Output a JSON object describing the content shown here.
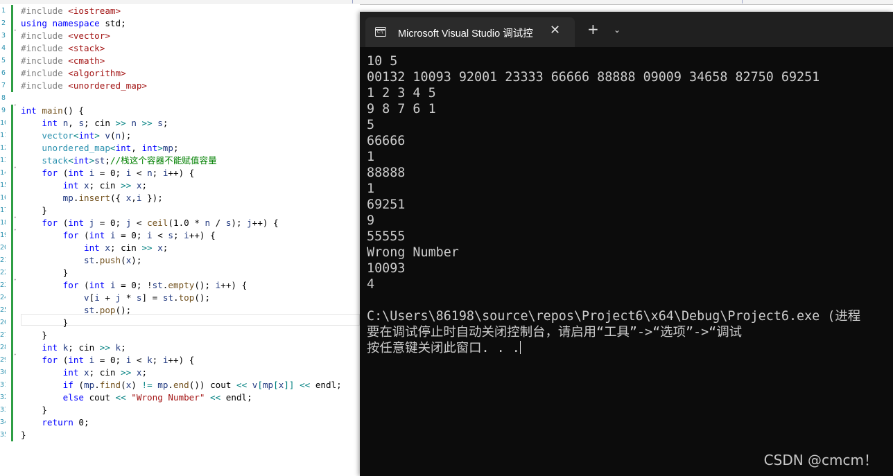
{
  "editor": {
    "line_numbers": [
      "1",
      "2",
      "3",
      "4",
      "5",
      "6",
      "7",
      "8",
      "9",
      "10",
      "11",
      "12",
      "13",
      "14",
      "15",
      "16",
      "17",
      "18",
      "19",
      "20",
      "21",
      "22",
      "23",
      "24",
      "25",
      "26",
      "27",
      "28",
      "29",
      "30",
      "31",
      "32",
      "33",
      "34",
      "35"
    ],
    "lines": [
      [
        [
          "pp",
          "#include "
        ],
        [
          "str",
          "<iostream>"
        ]
      ],
      [
        [
          "kw",
          "using namespace "
        ],
        [
          "",
          "std;"
        ]
      ],
      [
        [
          "pp",
          "#include "
        ],
        [
          "str",
          "<vector>"
        ]
      ],
      [
        [
          "pp",
          "#include "
        ],
        [
          "str",
          "<stack>"
        ]
      ],
      [
        [
          "pp",
          "#include "
        ],
        [
          "str",
          "<cmath>"
        ]
      ],
      [
        [
          "pp",
          "#include "
        ],
        [
          "str",
          "<algorithm>"
        ]
      ],
      [
        [
          "pp",
          "#include "
        ],
        [
          "str",
          "<unordered_map>"
        ]
      ],
      [],
      [
        [
          "kw",
          "int "
        ],
        [
          "fn",
          "main"
        ],
        [
          "",
          "() {"
        ]
      ],
      [
        [
          "",
          "    "
        ],
        [
          "kw",
          "int "
        ],
        [
          "var",
          "n"
        ],
        [
          "",
          ", "
        ],
        [
          "var",
          "s"
        ],
        [
          "",
          "; cin "
        ],
        [
          "op",
          ">>"
        ],
        [
          "",
          " "
        ],
        [
          "var",
          "n"
        ],
        [
          "",
          " "
        ],
        [
          "op",
          ">>"
        ],
        [
          "",
          " "
        ],
        [
          "var",
          "s"
        ],
        [
          "",
          ";"
        ]
      ],
      [
        [
          "",
          "    "
        ],
        [
          "typ",
          "vector"
        ],
        [
          "op",
          "<"
        ],
        [
          "kw",
          "int"
        ],
        [
          "op",
          ">"
        ],
        [
          "",
          " "
        ],
        [
          "var",
          "v"
        ],
        [
          "",
          "("
        ],
        [
          "var",
          "n"
        ],
        [
          "",
          ");"
        ]
      ],
      [
        [
          "",
          "    "
        ],
        [
          "typ",
          "unordered_map"
        ],
        [
          "op",
          "<"
        ],
        [
          "kw",
          "int"
        ],
        [
          "",
          ", "
        ],
        [
          "kw",
          "int"
        ],
        [
          "op",
          ">"
        ],
        [
          "var",
          "mp"
        ],
        [
          "",
          ";"
        ]
      ],
      [
        [
          "",
          "    "
        ],
        [
          "typ",
          "stack"
        ],
        [
          "op",
          "<"
        ],
        [
          "kw",
          "int"
        ],
        [
          "op",
          ">"
        ],
        [
          "var",
          "st"
        ],
        [
          "",
          ";"
        ],
        [
          "cmt",
          "//栈这个容器不能赋值容量"
        ]
      ],
      [
        [
          "",
          "    "
        ],
        [
          "kw",
          "for "
        ],
        [
          "",
          "("
        ],
        [
          "kw",
          "int "
        ],
        [
          "var",
          "i"
        ],
        [
          "",
          " = 0; "
        ],
        [
          "var",
          "i"
        ],
        [
          "",
          " < "
        ],
        [
          "var",
          "n"
        ],
        [
          "",
          "; "
        ],
        [
          "var",
          "i"
        ],
        [
          "",
          "++) {"
        ]
      ],
      [
        [
          "",
          "        "
        ],
        [
          "kw",
          "int "
        ],
        [
          "var",
          "x"
        ],
        [
          "",
          "; cin "
        ],
        [
          "op",
          ">>"
        ],
        [
          "",
          " "
        ],
        [
          "var",
          "x"
        ],
        [
          "",
          ";"
        ]
      ],
      [
        [
          "",
          "        "
        ],
        [
          "var",
          "mp"
        ],
        [
          "",
          "."
        ],
        [
          "fn",
          "insert"
        ],
        [
          "",
          "({ "
        ],
        [
          "var",
          "x"
        ],
        [
          "",
          ","
        ],
        [
          "var",
          "i"
        ],
        [
          "",
          " });"
        ]
      ],
      [
        [
          "",
          "    }"
        ]
      ],
      [
        [
          "",
          "    "
        ],
        [
          "kw",
          "for "
        ],
        [
          "",
          "("
        ],
        [
          "kw",
          "int "
        ],
        [
          "var",
          "j"
        ],
        [
          "",
          " = 0; "
        ],
        [
          "var",
          "j"
        ],
        [
          "",
          " < "
        ],
        [
          "fn",
          "ceil"
        ],
        [
          "",
          "(1.0 * "
        ],
        [
          "var",
          "n"
        ],
        [
          "",
          " / "
        ],
        [
          "var",
          "s"
        ],
        [
          "",
          "); "
        ],
        [
          "var",
          "j"
        ],
        [
          "",
          "++) {"
        ]
      ],
      [
        [
          "",
          "        "
        ],
        [
          "kw",
          "for "
        ],
        [
          "",
          "("
        ],
        [
          "kw",
          "int "
        ],
        [
          "var",
          "i"
        ],
        [
          "",
          " = 0; "
        ],
        [
          "var",
          "i"
        ],
        [
          "",
          " < "
        ],
        [
          "var",
          "s"
        ],
        [
          "",
          "; "
        ],
        [
          "var",
          "i"
        ],
        [
          "",
          "++) {"
        ]
      ],
      [
        [
          "",
          "            "
        ],
        [
          "kw",
          "int "
        ],
        [
          "var",
          "x"
        ],
        [
          "",
          "; cin "
        ],
        [
          "op",
          ">>"
        ],
        [
          "",
          " "
        ],
        [
          "var",
          "x"
        ],
        [
          "",
          ";"
        ]
      ],
      [
        [
          "",
          "            "
        ],
        [
          "var",
          "st"
        ],
        [
          "",
          "."
        ],
        [
          "fn",
          "push"
        ],
        [
          "",
          "("
        ],
        [
          "var",
          "x"
        ],
        [
          "",
          ");"
        ]
      ],
      [
        [
          "",
          "        }"
        ]
      ],
      [
        [
          "",
          "        "
        ],
        [
          "kw",
          "for "
        ],
        [
          "",
          "("
        ],
        [
          "kw",
          "int "
        ],
        [
          "var",
          "i"
        ],
        [
          "",
          " = 0; !"
        ],
        [
          "var",
          "st"
        ],
        [
          "",
          "."
        ],
        [
          "fn",
          "empty"
        ],
        [
          "",
          "(); "
        ],
        [
          "var",
          "i"
        ],
        [
          "",
          "++) {"
        ]
      ],
      [
        [
          "",
          "            "
        ],
        [
          "var",
          "v"
        ],
        [
          "",
          "["
        ],
        [
          "var",
          "i"
        ],
        [
          "",
          " + "
        ],
        [
          "var",
          "j"
        ],
        [
          "",
          " * "
        ],
        [
          "var",
          "s"
        ],
        [
          "",
          "] = "
        ],
        [
          "var",
          "st"
        ],
        [
          "",
          "."
        ],
        [
          "fn",
          "top"
        ],
        [
          "",
          "();"
        ]
      ],
      [
        [
          "",
          "            "
        ],
        [
          "var",
          "st"
        ],
        [
          "",
          "."
        ],
        [
          "fn",
          "pop"
        ],
        [
          "",
          "();"
        ]
      ],
      [
        [
          "",
          "        }"
        ]
      ],
      [
        [
          "",
          "    }"
        ]
      ],
      [
        [
          "",
          "    "
        ],
        [
          "kw",
          "int "
        ],
        [
          "var",
          "k"
        ],
        [
          "",
          "; cin "
        ],
        [
          "op",
          ">>"
        ],
        [
          "",
          " "
        ],
        [
          "var",
          "k"
        ],
        [
          "",
          ";"
        ]
      ],
      [
        [
          "",
          "    "
        ],
        [
          "kw",
          "for "
        ],
        [
          "",
          "("
        ],
        [
          "kw",
          "int "
        ],
        [
          "var",
          "i"
        ],
        [
          "",
          " = 0; "
        ],
        [
          "var",
          "i"
        ],
        [
          "",
          " < "
        ],
        [
          "var",
          "k"
        ],
        [
          "",
          "; "
        ],
        [
          "var",
          "i"
        ],
        [
          "",
          "++) {"
        ]
      ],
      [
        [
          "",
          "        "
        ],
        [
          "kw",
          "int "
        ],
        [
          "var",
          "x"
        ],
        [
          "",
          "; cin "
        ],
        [
          "op",
          ">>"
        ],
        [
          "",
          " "
        ],
        [
          "var",
          "x"
        ],
        [
          "",
          ";"
        ]
      ],
      [
        [
          "",
          "        "
        ],
        [
          "kw",
          "if "
        ],
        [
          "",
          "("
        ],
        [
          "var",
          "mp"
        ],
        [
          "",
          "."
        ],
        [
          "fn",
          "find"
        ],
        [
          "",
          "("
        ],
        [
          "var",
          "x"
        ],
        [
          "",
          ") "
        ],
        [
          "op",
          "!="
        ],
        [
          "",
          " "
        ],
        [
          "var",
          "mp"
        ],
        [
          "",
          "."
        ],
        [
          "fn",
          "end"
        ],
        [
          "",
          "()) cout "
        ],
        [
          "op",
          "<<"
        ],
        [
          "",
          " "
        ],
        [
          "var",
          "v"
        ],
        [
          "op",
          "["
        ],
        [
          "var",
          "mp"
        ],
        [
          "op",
          "["
        ],
        [
          "var",
          "x"
        ],
        [
          "op",
          "]]"
        ],
        [
          "",
          " "
        ],
        [
          "op",
          "<<"
        ],
        [
          "",
          " endl;"
        ]
      ],
      [
        [
          "",
          "        "
        ],
        [
          "kw",
          "else "
        ],
        [
          "",
          "cout "
        ],
        [
          "op",
          "<<"
        ],
        [
          "",
          " "
        ],
        [
          "str",
          "\"Wrong Number\""
        ],
        [
          "",
          " "
        ],
        [
          "op",
          "<<"
        ],
        [
          "",
          " endl;"
        ]
      ],
      [
        [
          "",
          "    }"
        ]
      ],
      [
        [
          "",
          "    "
        ],
        [
          "kw",
          "return "
        ],
        [
          "",
          "0;"
        ]
      ],
      [
        [
          "",
          "}"
        ]
      ]
    ]
  },
  "terminal": {
    "tab_title": "Microsoft Visual Studio 调试控",
    "tab_icon_text": "C:\\",
    "close_glyph": "✕",
    "new_tab_glyph": "+",
    "dropdown_glyph": "⌄",
    "lines": [
      "10 5",
      "00132 10093 92001 23333 66666 88888 09009 34658 82750 69251",
      "1 2 3 4 5",
      "9 8 7 6 1",
      "5",
      "66666",
      "1",
      "88888",
      "1",
      "69251",
      "9",
      "55555",
      "Wrong Number",
      "10093",
      "4",
      "",
      "C:\\Users\\86198\\source\\repos\\Project6\\x64\\Debug\\Project6.exe (进程",
      "要在调试停止时自动关闭控制台，请启用“工具”->“选项”->“调试",
      "按任意键关闭此窗口. . ."
    ]
  },
  "watermark": "CSDN @cmcm！"
}
